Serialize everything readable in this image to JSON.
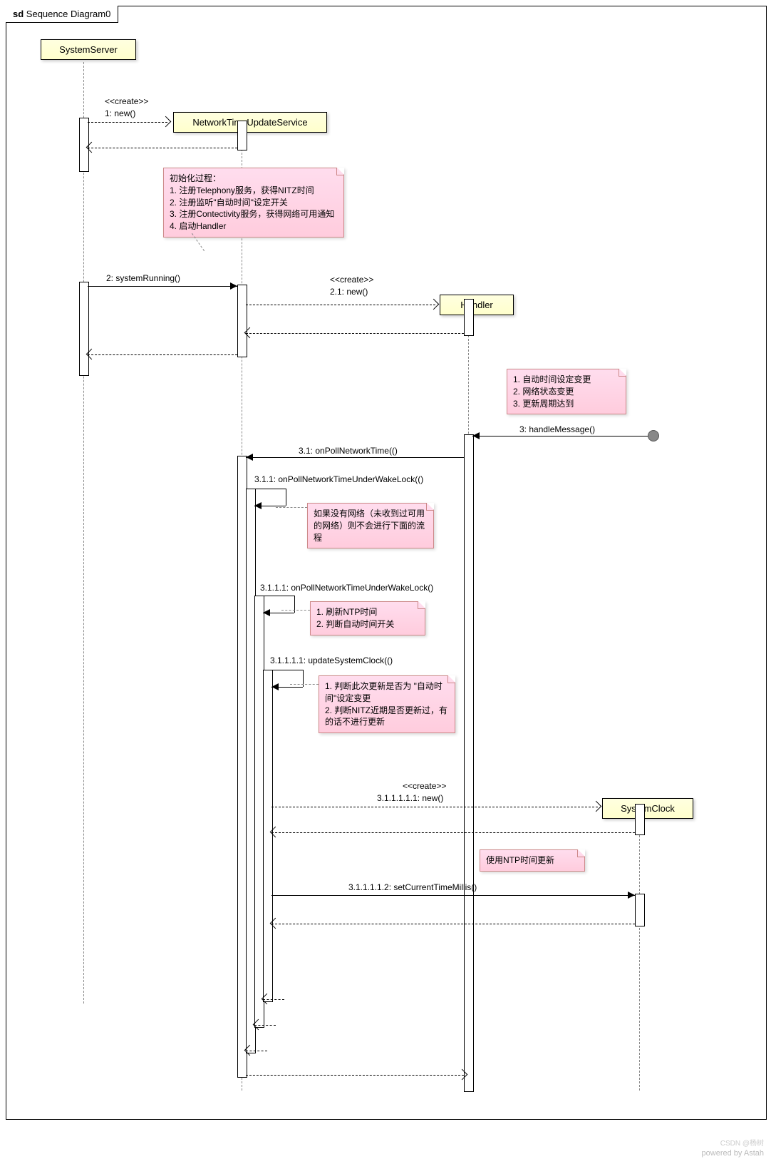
{
  "frame": {
    "prefix": "sd",
    "name": "Sequence Diagram0"
  },
  "lifelines": {
    "systemServer": "SystemServer",
    "ntus": "NetworkTimeUpdateService",
    "handler": "Handler",
    "systemClock": "SystemClock"
  },
  "messages": {
    "create1_stereo": "<<create>>",
    "create1": "1: new()",
    "m2": "2: systemRunning()",
    "create21_stereo": "<<create>>",
    "create21": "2.1: new()",
    "m3": "3: handleMessage()",
    "m31": "3.1: onPollNetworkTime(()",
    "m311": "3.1.1: onPollNetworkTimeUnderWakeLock(()",
    "m3111": "3.1.1.1: onPollNetworkTimeUnderWakeLock()",
    "m31111": "3.1.1.1.1: updateSystemClock(()",
    "create311111_stereo": "<<create>>",
    "create311111": "3.1.1.1.1.1: new()",
    "m311112": "3.1.1.1.1.2: setCurrentTimeMillis()"
  },
  "notes": {
    "init": "初始化过程：\n1. 注册Telephony服务，获得NITZ时间\n2. 注册监听\"自动时间\"设定开关\n3. 注册Contectivity服务，获得网络可用通知\n4. 启动Handler",
    "handlerTrigger": "1. 自动时间设定变更\n2. 网络状态变更\n3. 更新周期达到",
    "noNetwork": "如果没有网络（未收到过可用的网络）则不会进行下面的流程",
    "refresh": "1. 刷新NTP时间\n2. 判断自动时间开关",
    "judge": "1. 判断此次更新是否为 \"自动时间\"设定变更\n2. 判断NITZ近期是否更新过，有的话不进行更新",
    "ntp": "使用NTP时间更新"
  },
  "footer": "powered by Astah",
  "watermark": "CSDN @杨树"
}
